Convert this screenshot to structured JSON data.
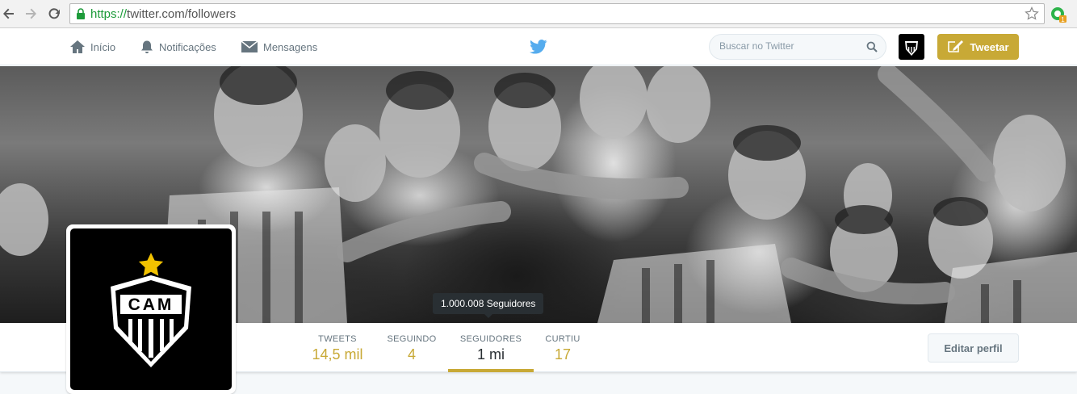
{
  "browser": {
    "url_scheme": "https://",
    "url_rest": "twitter.com/followers",
    "icons": [
      "back-icon",
      "forward-icon",
      "reload-icon",
      "lock-icon",
      "star-icon",
      "extension-icon"
    ]
  },
  "topbar": {
    "home_label": "Início",
    "notifications_label": "Notificações",
    "messages_label": "Mensagens",
    "search_placeholder": "Buscar no Twitter",
    "tweet_button": "Tweetar",
    "accent_color": "#c8a936"
  },
  "banner": {
    "tooltip": "1.000.008 Seguidores"
  },
  "profile_avatar": {
    "letters": "CAM"
  },
  "stats": [
    {
      "label": "TWEETS",
      "value": "14,5 mil"
    },
    {
      "label": "SEGUINDO",
      "value": "4"
    },
    {
      "label": "SEGUIDORES",
      "value": "1 mi"
    },
    {
      "label": "CURTIU",
      "value": "17"
    }
  ],
  "edit_profile_button": "Editar perfil"
}
